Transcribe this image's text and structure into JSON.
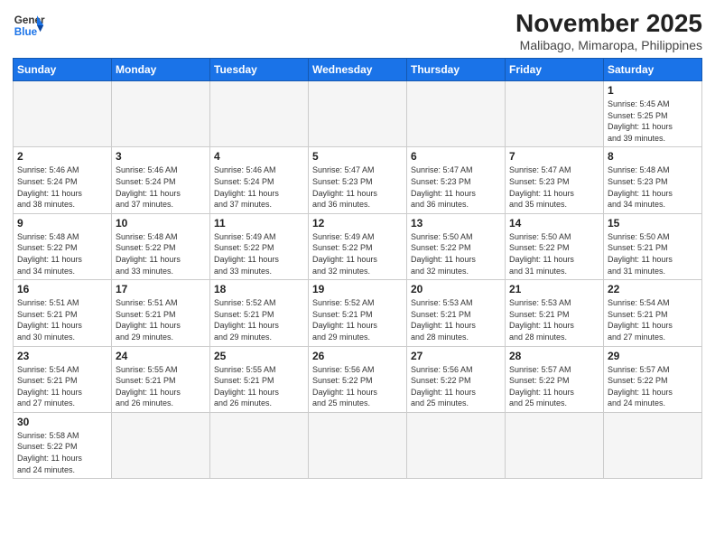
{
  "header": {
    "logo_line1": "General",
    "logo_line2": "Blue",
    "month_title": "November 2025",
    "location": "Malibago, Mimaropa, Philippines"
  },
  "weekdays": [
    "Sunday",
    "Monday",
    "Tuesday",
    "Wednesday",
    "Thursday",
    "Friday",
    "Saturday"
  ],
  "weeks": [
    [
      {
        "day": "",
        "info": ""
      },
      {
        "day": "",
        "info": ""
      },
      {
        "day": "",
        "info": ""
      },
      {
        "day": "",
        "info": ""
      },
      {
        "day": "",
        "info": ""
      },
      {
        "day": "",
        "info": ""
      },
      {
        "day": "1",
        "info": "Sunrise: 5:45 AM\nSunset: 5:25 PM\nDaylight: 11 hours\nand 39 minutes."
      }
    ],
    [
      {
        "day": "2",
        "info": "Sunrise: 5:46 AM\nSunset: 5:24 PM\nDaylight: 11 hours\nand 38 minutes."
      },
      {
        "day": "3",
        "info": "Sunrise: 5:46 AM\nSunset: 5:24 PM\nDaylight: 11 hours\nand 37 minutes."
      },
      {
        "day": "4",
        "info": "Sunrise: 5:46 AM\nSunset: 5:24 PM\nDaylight: 11 hours\nand 37 minutes."
      },
      {
        "day": "5",
        "info": "Sunrise: 5:47 AM\nSunset: 5:23 PM\nDaylight: 11 hours\nand 36 minutes."
      },
      {
        "day": "6",
        "info": "Sunrise: 5:47 AM\nSunset: 5:23 PM\nDaylight: 11 hours\nand 36 minutes."
      },
      {
        "day": "7",
        "info": "Sunrise: 5:47 AM\nSunset: 5:23 PM\nDaylight: 11 hours\nand 35 minutes."
      },
      {
        "day": "8",
        "info": "Sunrise: 5:48 AM\nSunset: 5:23 PM\nDaylight: 11 hours\nand 34 minutes."
      }
    ],
    [
      {
        "day": "9",
        "info": "Sunrise: 5:48 AM\nSunset: 5:22 PM\nDaylight: 11 hours\nand 34 minutes."
      },
      {
        "day": "10",
        "info": "Sunrise: 5:48 AM\nSunset: 5:22 PM\nDaylight: 11 hours\nand 33 minutes."
      },
      {
        "day": "11",
        "info": "Sunrise: 5:49 AM\nSunset: 5:22 PM\nDaylight: 11 hours\nand 33 minutes."
      },
      {
        "day": "12",
        "info": "Sunrise: 5:49 AM\nSunset: 5:22 PM\nDaylight: 11 hours\nand 32 minutes."
      },
      {
        "day": "13",
        "info": "Sunrise: 5:50 AM\nSunset: 5:22 PM\nDaylight: 11 hours\nand 32 minutes."
      },
      {
        "day": "14",
        "info": "Sunrise: 5:50 AM\nSunset: 5:22 PM\nDaylight: 11 hours\nand 31 minutes."
      },
      {
        "day": "15",
        "info": "Sunrise: 5:50 AM\nSunset: 5:21 PM\nDaylight: 11 hours\nand 31 minutes."
      }
    ],
    [
      {
        "day": "16",
        "info": "Sunrise: 5:51 AM\nSunset: 5:21 PM\nDaylight: 11 hours\nand 30 minutes."
      },
      {
        "day": "17",
        "info": "Sunrise: 5:51 AM\nSunset: 5:21 PM\nDaylight: 11 hours\nand 29 minutes."
      },
      {
        "day": "18",
        "info": "Sunrise: 5:52 AM\nSunset: 5:21 PM\nDaylight: 11 hours\nand 29 minutes."
      },
      {
        "day": "19",
        "info": "Sunrise: 5:52 AM\nSunset: 5:21 PM\nDaylight: 11 hours\nand 29 minutes."
      },
      {
        "day": "20",
        "info": "Sunrise: 5:53 AM\nSunset: 5:21 PM\nDaylight: 11 hours\nand 28 minutes."
      },
      {
        "day": "21",
        "info": "Sunrise: 5:53 AM\nSunset: 5:21 PM\nDaylight: 11 hours\nand 28 minutes."
      },
      {
        "day": "22",
        "info": "Sunrise: 5:54 AM\nSunset: 5:21 PM\nDaylight: 11 hours\nand 27 minutes."
      }
    ],
    [
      {
        "day": "23",
        "info": "Sunrise: 5:54 AM\nSunset: 5:21 PM\nDaylight: 11 hours\nand 27 minutes."
      },
      {
        "day": "24",
        "info": "Sunrise: 5:55 AM\nSunset: 5:21 PM\nDaylight: 11 hours\nand 26 minutes."
      },
      {
        "day": "25",
        "info": "Sunrise: 5:55 AM\nSunset: 5:21 PM\nDaylight: 11 hours\nand 26 minutes."
      },
      {
        "day": "26",
        "info": "Sunrise: 5:56 AM\nSunset: 5:22 PM\nDaylight: 11 hours\nand 25 minutes."
      },
      {
        "day": "27",
        "info": "Sunrise: 5:56 AM\nSunset: 5:22 PM\nDaylight: 11 hours\nand 25 minutes."
      },
      {
        "day": "28",
        "info": "Sunrise: 5:57 AM\nSunset: 5:22 PM\nDaylight: 11 hours\nand 25 minutes."
      },
      {
        "day": "29",
        "info": "Sunrise: 5:57 AM\nSunset: 5:22 PM\nDaylight: 11 hours\nand 24 minutes."
      }
    ],
    [
      {
        "day": "30",
        "info": "Sunrise: 5:58 AM\nSunset: 5:22 PM\nDaylight: 11 hours\nand 24 minutes."
      },
      {
        "day": "",
        "info": ""
      },
      {
        "day": "",
        "info": ""
      },
      {
        "day": "",
        "info": ""
      },
      {
        "day": "",
        "info": ""
      },
      {
        "day": "",
        "info": ""
      },
      {
        "day": "",
        "info": ""
      }
    ]
  ]
}
